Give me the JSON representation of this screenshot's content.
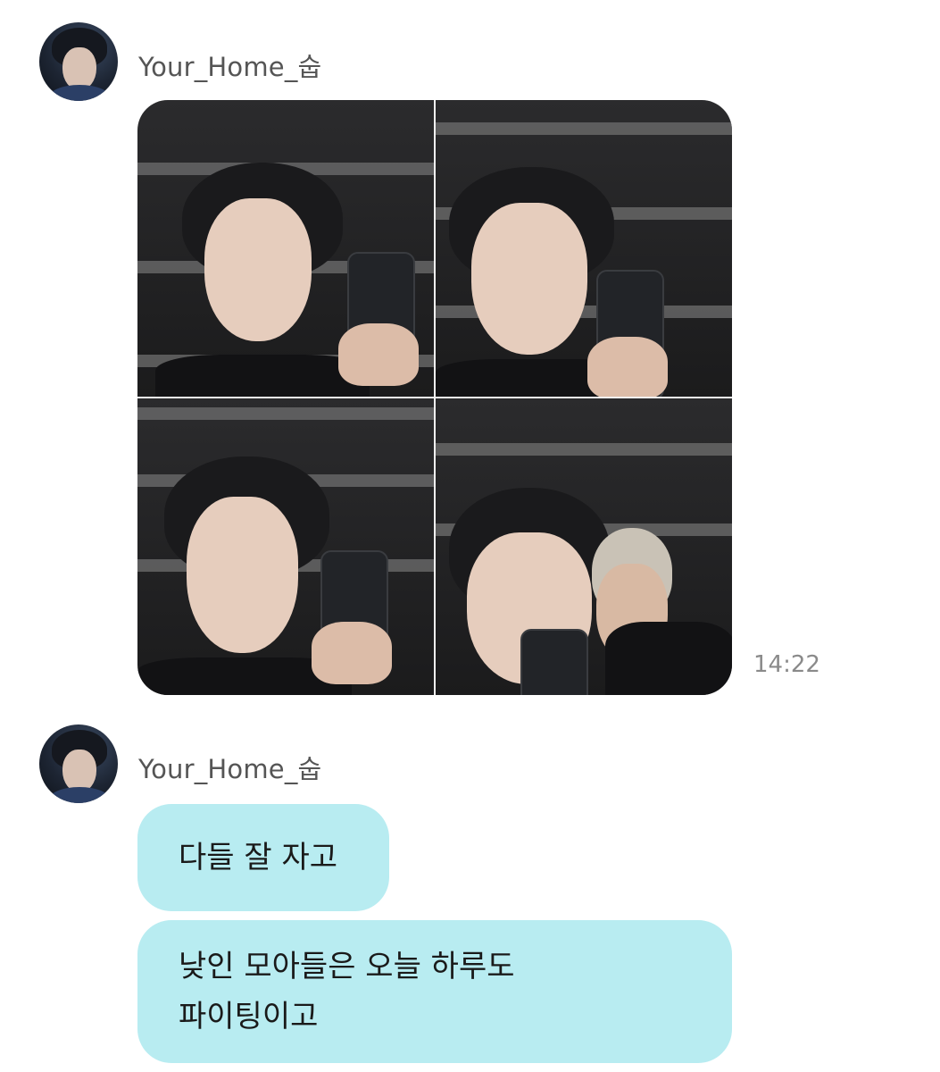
{
  "messages": [
    {
      "sender": "Your_Home_숩",
      "type": "image",
      "timestamp": "14:22",
      "image_count": 4
    },
    {
      "sender": "Your_Home_숩",
      "type": "text",
      "bubbles": [
        {
          "text": "다들 잘 자고"
        },
        {
          "line1": "낮인 모아들은 오늘 하루도",
          "line2": "파이팅이고"
        }
      ]
    }
  ],
  "colors": {
    "bubble": "#b8ecf1",
    "sender_text": "#555555",
    "timestamp_text": "#8a8a8a"
  }
}
